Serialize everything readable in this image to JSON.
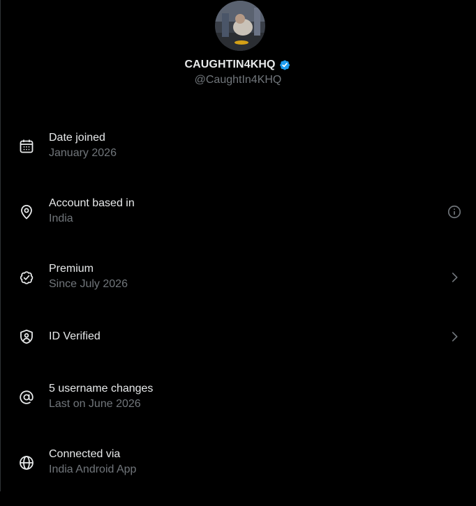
{
  "profile": {
    "display_name": "CAUGHTIN4KHQ",
    "handle": "@CaughtIn4KHQ",
    "verified": true,
    "badge_color": "#1d9bf0"
  },
  "info_items": [
    {
      "icon": "calendar-icon",
      "title": "Date joined",
      "subtitle": "January 2026",
      "trailing": null
    },
    {
      "icon": "location-pin-icon",
      "title": "Account based in",
      "subtitle": "India",
      "trailing": "info-icon"
    },
    {
      "icon": "verified-seal-icon",
      "title": "Premium",
      "subtitle": "Since July 2026",
      "trailing": "chevron-right-icon"
    },
    {
      "icon": "id-shield-icon",
      "title": "ID Verified",
      "subtitle": "",
      "trailing": "chevron-right-icon"
    },
    {
      "icon": "at-sign-icon",
      "title": "5 username changes",
      "subtitle": "Last on June 2026",
      "trailing": null
    },
    {
      "icon": "globe-icon",
      "title": "Connected via",
      "subtitle": "India Android App",
      "trailing": null
    }
  ],
  "colors": {
    "background": "#000000",
    "primary_text": "#e7e9ea",
    "secondary_text": "#71767b",
    "icon": "#e7e9ea",
    "trailing_icon": "#71767b"
  }
}
